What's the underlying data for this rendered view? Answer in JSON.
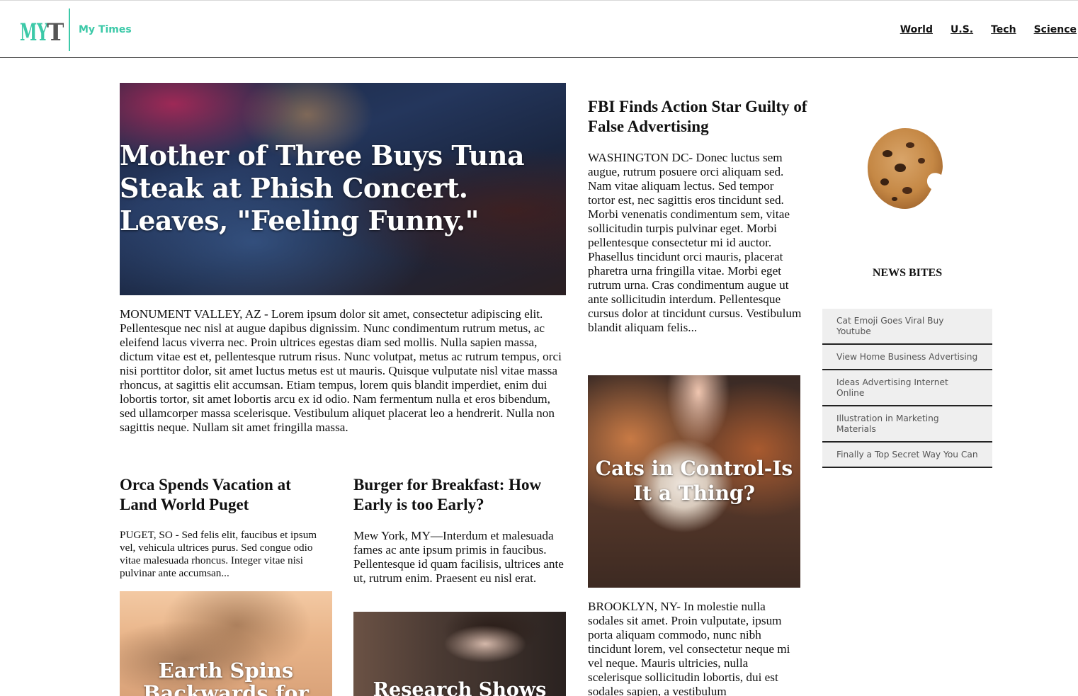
{
  "header": {
    "logo_text": "MYT",
    "brand": "My Times",
    "nav": [
      "World",
      "U.S.",
      "Tech",
      "Science"
    ]
  },
  "hero": {
    "title": "Mother of Three Buys Tuna Steak at Phish Concert. Leaves, \"Feeling Funny.\"",
    "body": "MONUMENT VALLEY, AZ - Lorem ipsum dolor sit amet, consectetur adipiscing elit. Pellentesque nec nisl at augue dapibus dignissim. Nunc condimentum rutrum metus, ac eleifend lacus viverra nec. Proin ultrices egestas diam sed mollis. Nulla sapien massa, dictum vitae est et, pellentesque rutrum risus. Nunc volutpat, metus ac rutrum tempus, orci nisi porttitor dolor, sit amet luctus metus est ut mauris. Quisque vulputate nisl vitae massa rhoncus, at sagittis elit accumsan. Etiam tempus, lorem quis blandit imperdiet, enim dui lobortis tortor, sit amet lobortis arcu ex id odio. Nam fermentum nulla et eros bibendum, sed ullamcorper massa scelerisque. Vestibulum aliquet placerat leo a hendrerit. Nulla non sagittis neque. Nullam sit amet fringilla massa."
  },
  "orca": {
    "title": "Orca Spends Vacation at Land World Puget",
    "body": "PUGET, SO - Sed felis elit, faucibus et ipsum vel, vehicula ultrices purus. Sed congue odio vitae malesuada rhoncus. Integer vitae nisi pulvinar ante accumsan..."
  },
  "earth": {
    "caption": "Earth Spins Backwards for"
  },
  "burger": {
    "title": "Burger for Breakfast: How Early is too Early?",
    "body": "Mew York, MY—Interdum et malesuada fames ac ante ipsum primis in faucibus. Pellentesque id quam facilisis, ultrices ante ut, rutrum enim. Praesent eu nisl erat."
  },
  "research": {
    "caption": "Research Shows"
  },
  "fbi": {
    "title": "FBI Finds Action Star Guilty of False Advertising",
    "body": "WASHINGTON DC- Donec luctus sem augue, rutrum posuere orci aliquam sed. Nam vitae aliquam lectus. Sed tempor tortor est, nec sagittis eros tincidunt sed. Morbi venenatis condimentum sem, vitae sollicitudin turpis pulvinar eget. Morbi pellentesque consectetur mi id auctor. Phasellus tincidunt orci mauris, placerat pharetra urna fringilla vitae. Morbi eget rutrum urna. Cras condimentum augue ut ante sollicitudin interdum. Pellentesque cursus dolor at tincidunt cursus. Vestibulum blandit aliquam felis..."
  },
  "cats": {
    "caption": "Cats in Control-Is It a Thing?",
    "body": "BROOKLYN, NY- In molestie nulla sodales sit amet. Proin vulputate, ipsum porta aliquam commodo, nunc nibh tincidunt lorem, vel consectetur neque mi vel neque. Mauris ultricies, nulla scelerisque sollicitudin lobortis, dui est sodales sapien, a vestibulum"
  },
  "news_bites": {
    "title": "NEWS BITES",
    "items": [
      "Cat Emoji Goes Viral Buy Youtube",
      "View Home Business Advertising",
      "Ideas Advertising Internet Online",
      "Illustration in Marketing Materials",
      "Finally a Top Secret Way You Can"
    ]
  },
  "colors": {
    "accent": "#3cc9a8",
    "text": "#111111",
    "bite_bg": "#efefef"
  },
  "icons": {
    "logo": "myt-logo",
    "cookie": "cookie-icon"
  }
}
